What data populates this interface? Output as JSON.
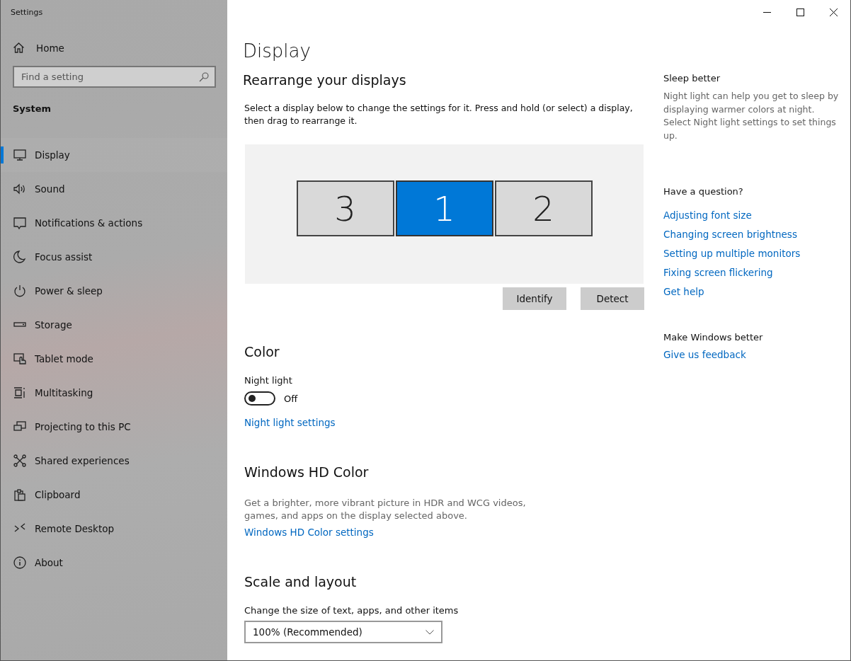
{
  "window": {
    "title": "Settings"
  },
  "sidebar": {
    "home": "Home",
    "search": {
      "placeholder": "Find a setting"
    },
    "section": "System",
    "items": [
      {
        "label": "Display",
        "selected": true
      },
      {
        "label": "Sound",
        "selected": false
      },
      {
        "label": "Notifications & actions",
        "selected": false
      },
      {
        "label": "Focus assist",
        "selected": false
      },
      {
        "label": "Power & sleep",
        "selected": false
      },
      {
        "label": "Storage",
        "selected": false
      },
      {
        "label": "Tablet mode",
        "selected": false
      },
      {
        "label": "Multitasking",
        "selected": false
      },
      {
        "label": "Projecting to this PC",
        "selected": false
      },
      {
        "label": "Shared experiences",
        "selected": false
      },
      {
        "label": "Clipboard",
        "selected": false
      },
      {
        "label": "Remote Desktop",
        "selected": false
      },
      {
        "label": "About",
        "selected": false
      }
    ]
  },
  "page": {
    "title": "Display",
    "rearrange": {
      "heading": "Rearrange your displays",
      "description": "Select a display below to change the settings for it. Press and hold (or select) a display, then drag to rearrange it.",
      "displays": [
        {
          "label": "3",
          "selected": false
        },
        {
          "label": "1",
          "selected": true
        },
        {
          "label": "2",
          "selected": false
        }
      ],
      "buttons": [
        "Identify",
        "Detect"
      ]
    },
    "color": {
      "heading": "Color",
      "night_light": {
        "label": "Night light",
        "on": false,
        "state_text": "Off"
      },
      "link": "Night light settings"
    },
    "hd_color": {
      "heading": "Windows HD Color",
      "description": "Get a brighter, more vibrant picture in HDR and WCG videos, games, and apps on the display selected above.",
      "link": "Windows HD Color settings"
    },
    "scale": {
      "heading": "Scale and layout",
      "label": "Change the size of text, apps, and other items",
      "dropdown": "100% (Recommended)"
    }
  },
  "aside": {
    "sleep": {
      "heading": "Sleep better",
      "text": "Night light can help you get to sleep by displaying warmer colors at night. Select Night light settings to set things up."
    },
    "question": {
      "heading": "Have a question?",
      "links": [
        "Adjusting font size",
        "Changing screen brightness",
        "Setting up multiple monitors",
        "Fixing screen flickering",
        "Get help"
      ]
    },
    "better": {
      "heading": "Make Windows better",
      "link": "Give us feedback"
    }
  }
}
